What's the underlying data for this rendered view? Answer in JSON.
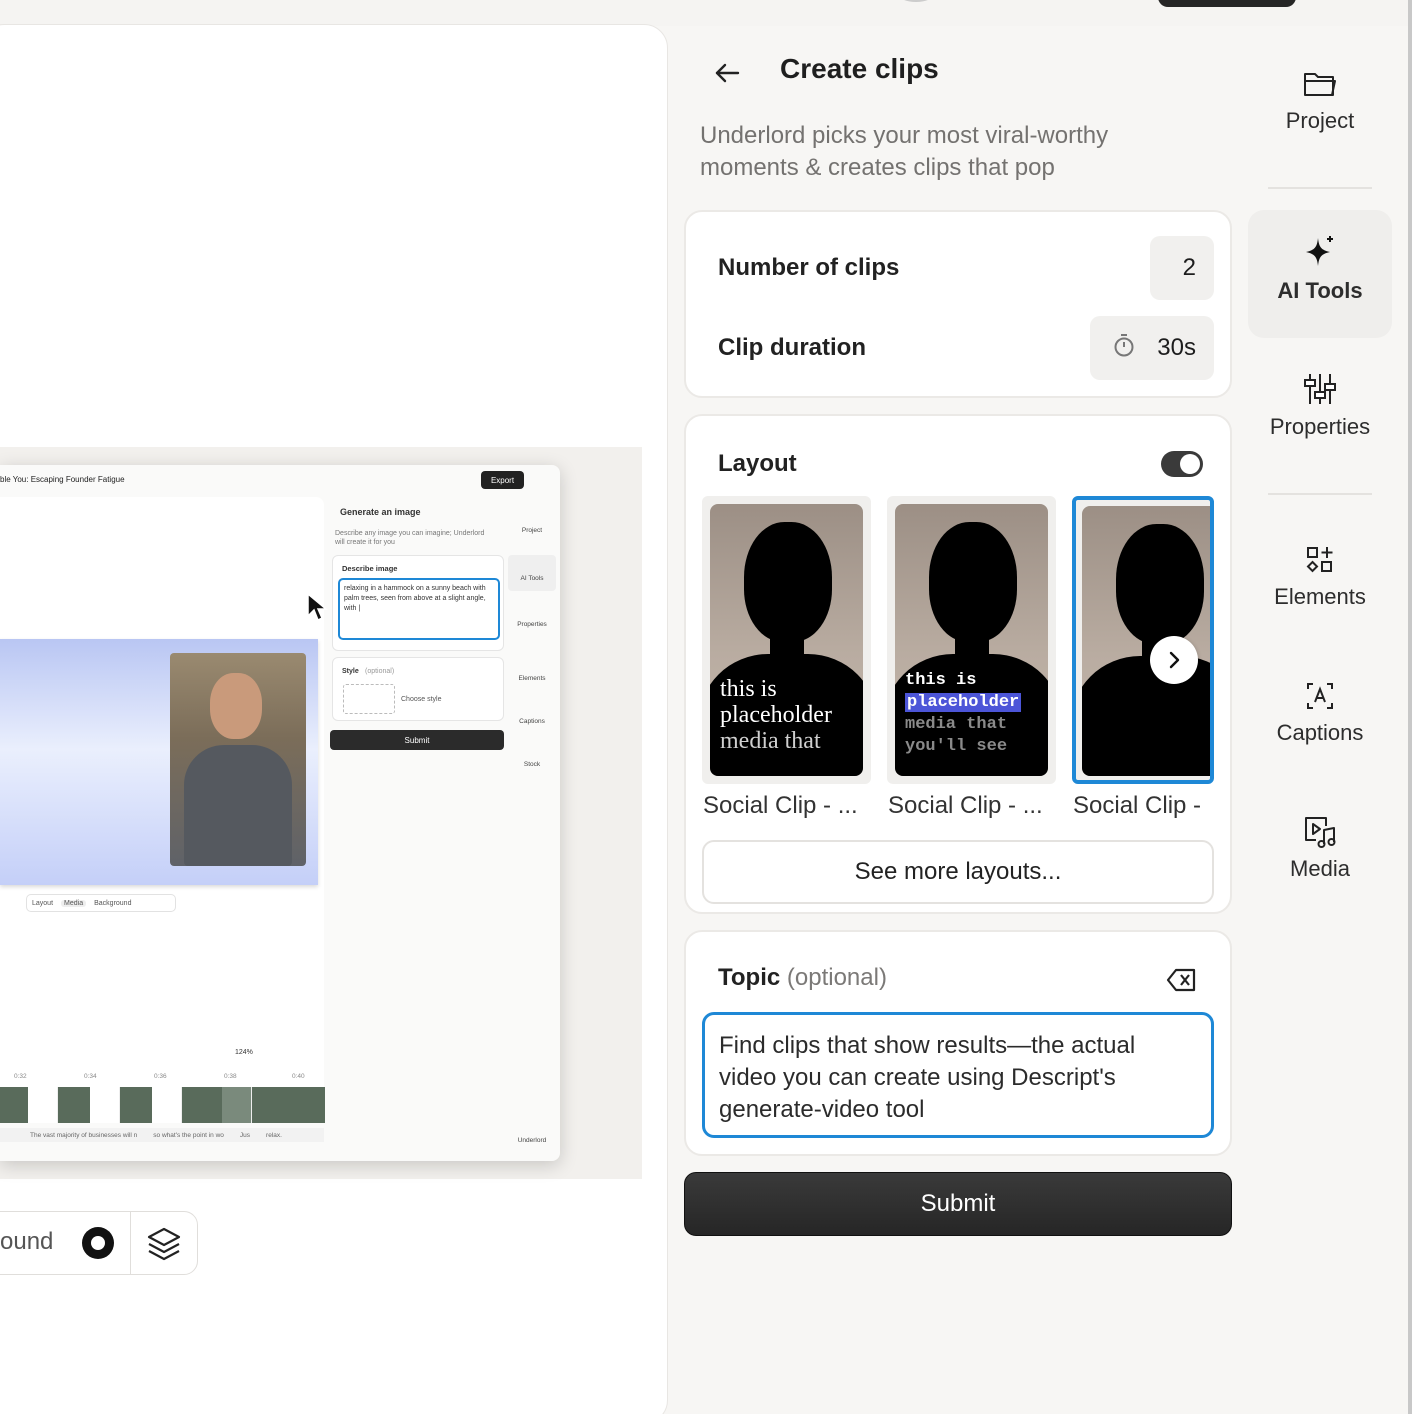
{
  "panel": {
    "title": "Create clips",
    "description": "Underlord picks your most viral-worthy moments & creates clips that pop",
    "settings": {
      "num_clips_label": "Number of clips",
      "num_clips_value": "2",
      "duration_label": "Clip duration",
      "duration_value": "30s"
    },
    "layout": {
      "label": "Layout",
      "toggle_on": true,
      "items": [
        {
          "name": "Social Clip - ...",
          "caption": [
            "this is",
            "placeholder",
            "media that"
          ]
        },
        {
          "name": "Social Clip - ...",
          "caption": [
            "this is",
            "placeholder",
            "media that",
            "you'll see"
          ]
        },
        {
          "name": "Social Clip -"
        }
      ],
      "see_more_label": "See more layouts..."
    },
    "topic": {
      "label": "Topic",
      "optional_label": "(optional)",
      "value": "Find clips that show results—the actual video you can create using Descript's generate-video tool"
    },
    "submit_label": "Submit"
  },
  "sidebar": {
    "items": [
      {
        "label": "Project",
        "icon": "folder-icon"
      },
      {
        "label": "AI Tools",
        "icon": "sparkle-icon",
        "active": true
      },
      {
        "label": "Properties",
        "icon": "sliders-icon"
      },
      {
        "label": "Elements",
        "icon": "shapes-icon"
      },
      {
        "label": "Captions",
        "icon": "captions-icon"
      },
      {
        "label": "Media",
        "icon": "media-icon"
      }
    ]
  },
  "canvas": {
    "toolbar_label": "ound",
    "preview": {
      "title": "ble You: Escaping Founder Fatigue",
      "export_label": "Export",
      "panel_title": "Generate an image",
      "panel_desc": "Describe any image you can imagine; Underlord will create it for you",
      "describe_label": "Describe image",
      "describe_text": "relaxing in a hammock on a sunny beach with palm trees, seen from above at a slight angle, with |",
      "style_label": "Style",
      "style_optional": "(optional)",
      "style_select": "Choose style",
      "submit_label": "Submit",
      "sidebar": [
        "Project",
        "AI Tools",
        "Properties",
        "Elements",
        "Captions",
        "Stock",
        "Underlord"
      ],
      "layout_bar": [
        "Layout",
        "Media",
        "Background"
      ],
      "zoom": "124%",
      "timecodes": [
        "0:32",
        "0:34",
        "0:36",
        "0:38",
        "0:40"
      ],
      "transcript": [
        "The vast majority of businesses will n",
        "so what's the point in wo",
        "Jus",
        "relax."
      ]
    }
  },
  "colors": {
    "accent": "#1e88d6",
    "dark": "#262626",
    "panel_bg": "#f7f6f4"
  }
}
